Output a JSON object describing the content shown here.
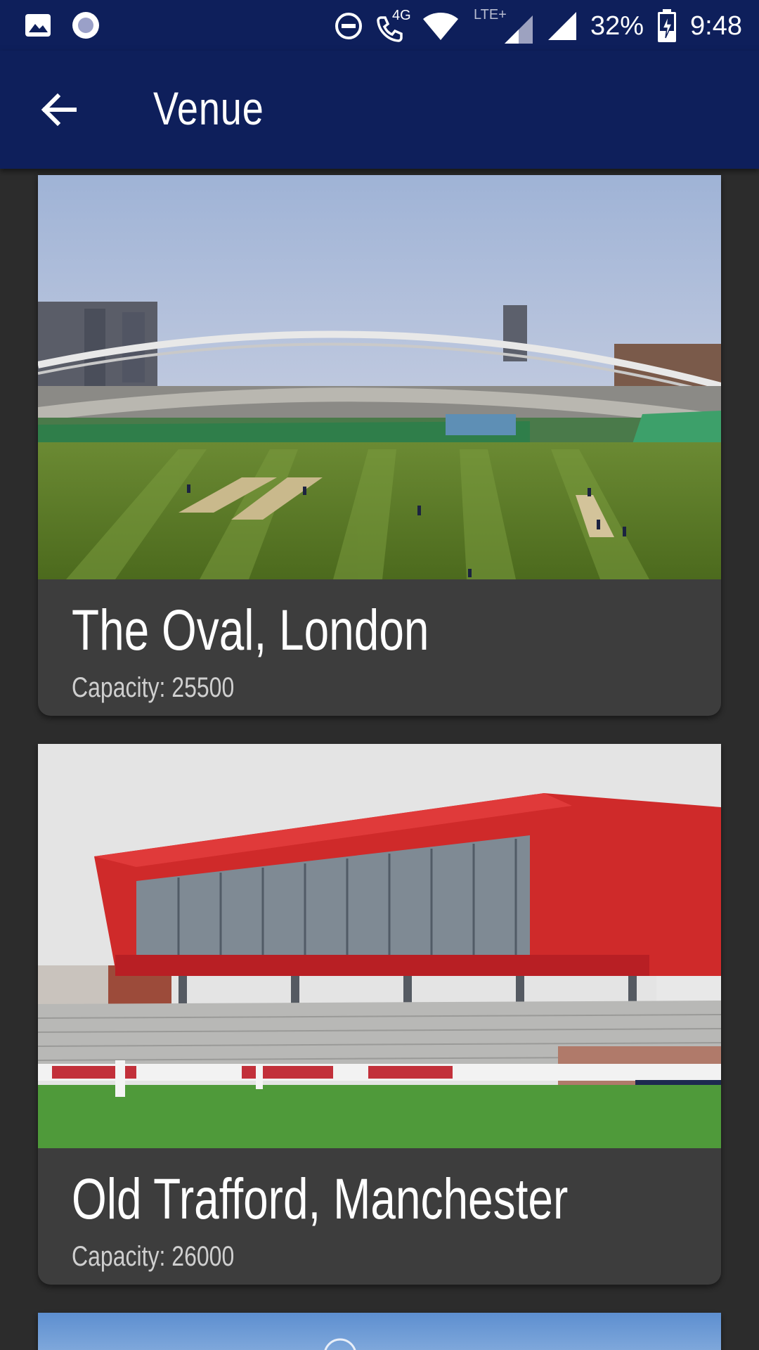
{
  "status_bar": {
    "network_label": "4G",
    "lte_label": "LTE+",
    "battery": "32%",
    "time": "9:48",
    "icons": [
      "image-icon",
      "record-icon",
      "do-not-disturb-icon",
      "wifi-calling-icon",
      "wifi-icon",
      "signal-icon",
      "battery-charging-icon"
    ]
  },
  "app_bar": {
    "title": "Venue",
    "back_icon": "arrow-back-icon"
  },
  "venues": [
    {
      "name": "The Oval, London",
      "capacity": "Capacity: 25500"
    },
    {
      "name": "Old Trafford, Manchester",
      "capacity": "Capacity: 26000"
    }
  ],
  "colors": {
    "primary": "#0e1f5b",
    "background": "#2c2c2c",
    "card": "#3d3d3d"
  }
}
